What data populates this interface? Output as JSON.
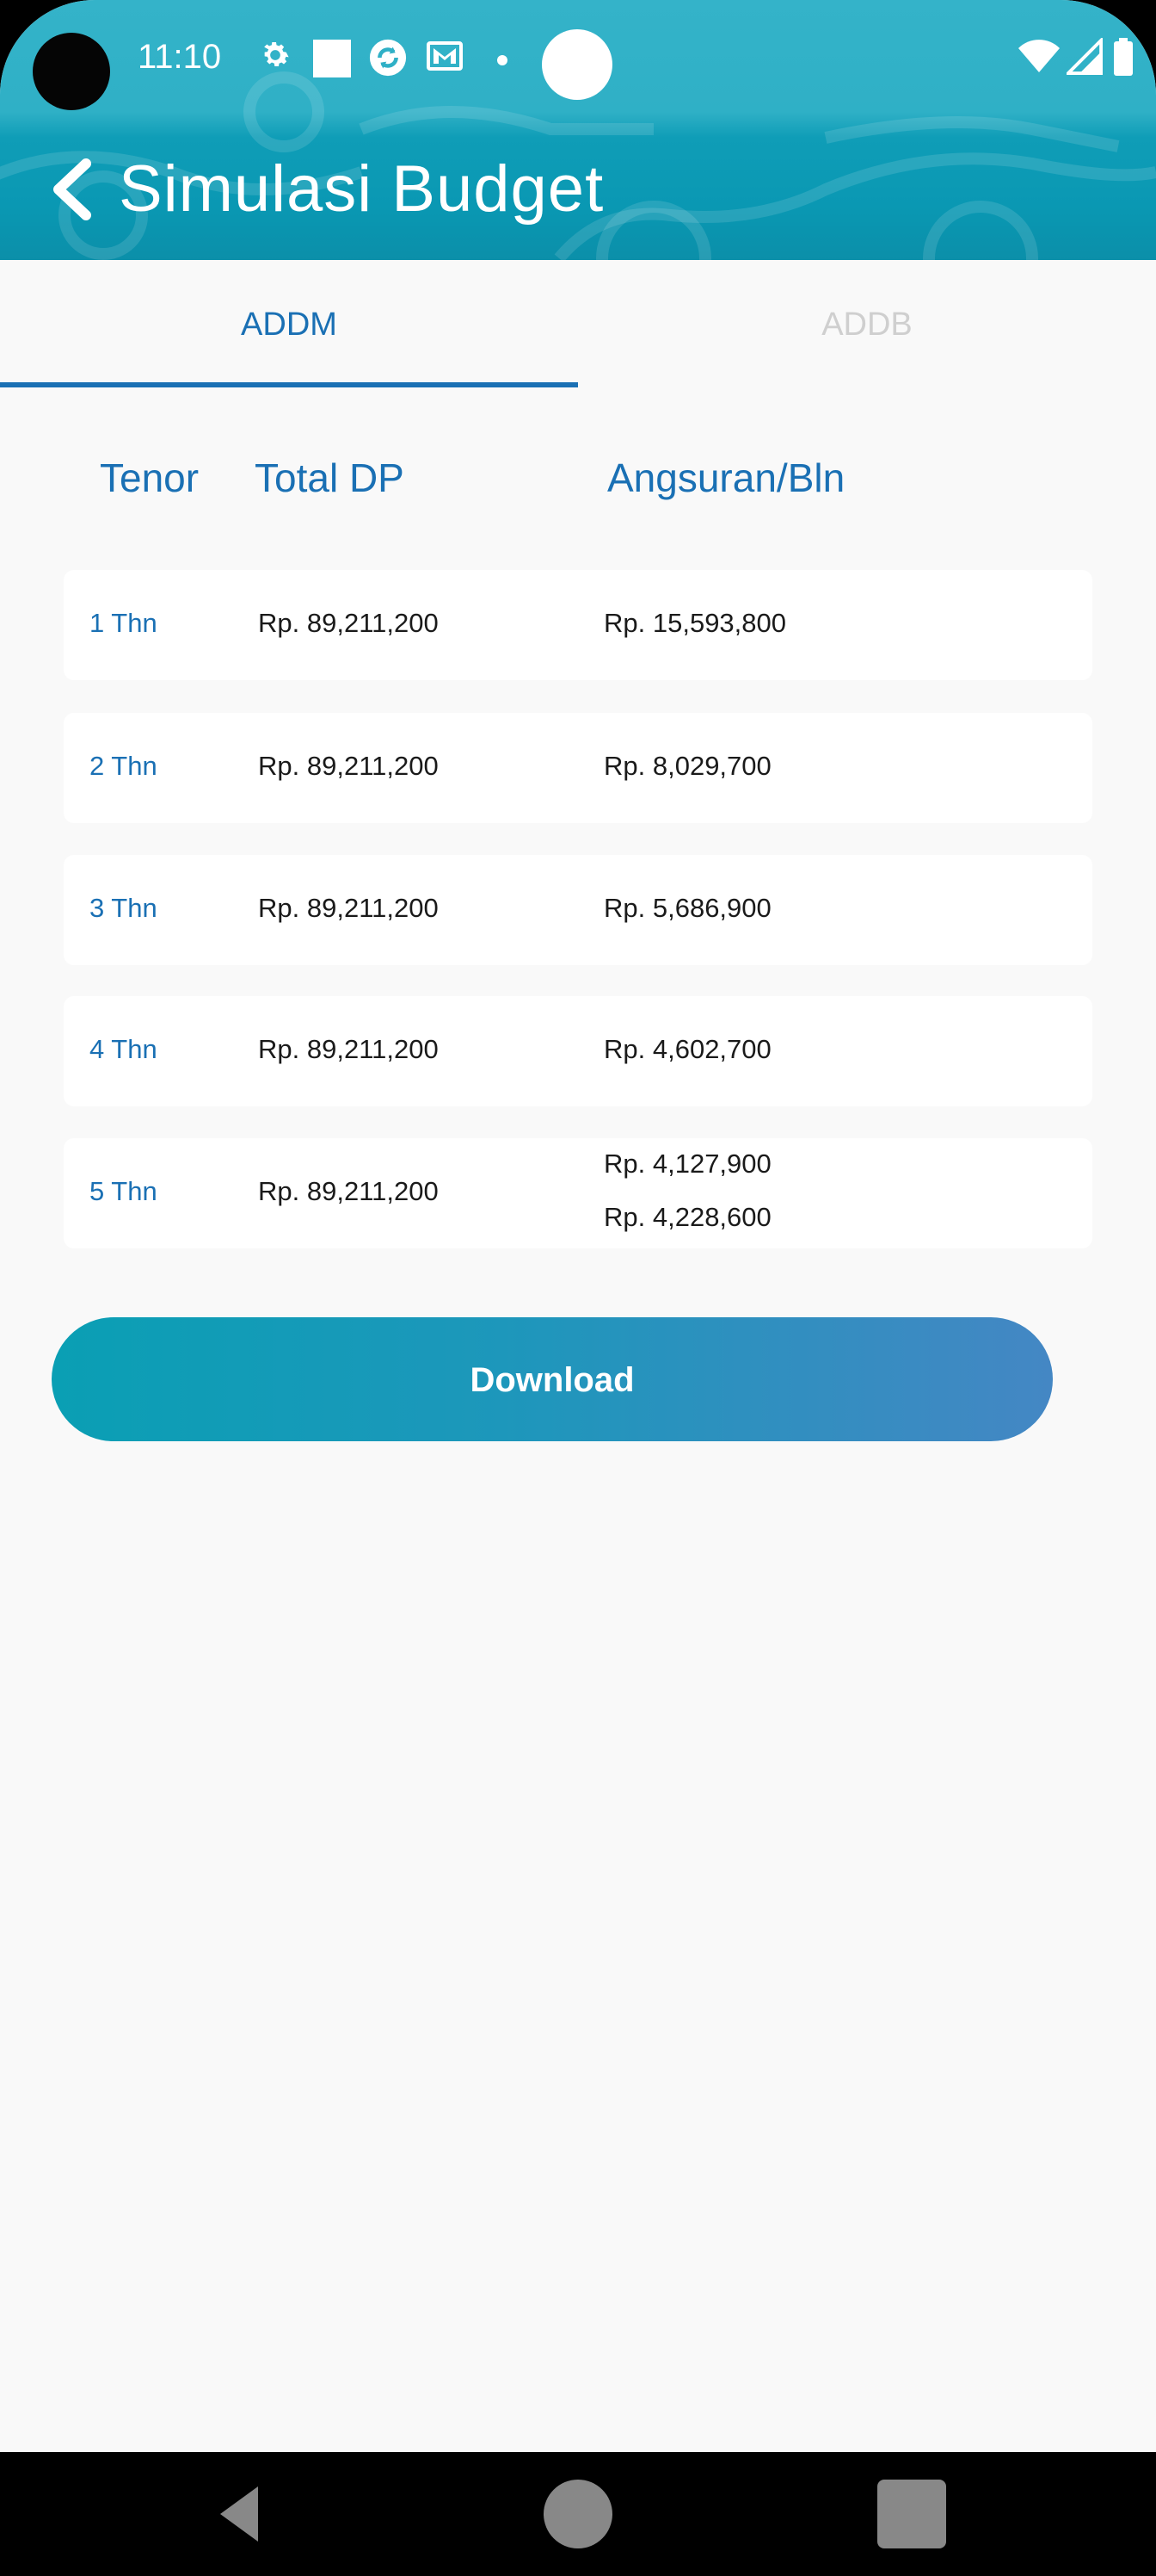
{
  "status_bar": {
    "time": "11:10"
  },
  "header": {
    "title": "Simulasi Budget"
  },
  "tabs": [
    {
      "label": "ADDM",
      "selected": true
    },
    {
      "label": "ADDB",
      "selected": false
    }
  ],
  "table": {
    "headers": [
      "Tenor",
      "Total DP",
      "Angsuran/Bln"
    ],
    "rows": [
      {
        "tenor": "1 Thn",
        "total_dp": "Rp. 89,211,200",
        "angsuran": [
          "Rp. 15,593,800"
        ]
      },
      {
        "tenor": "2 Thn",
        "total_dp": "Rp. 89,211,200",
        "angsuran": [
          "Rp. 8,029,700"
        ]
      },
      {
        "tenor": "3 Thn",
        "total_dp": "Rp. 89,211,200",
        "angsuran": [
          "Rp. 5,686,900"
        ]
      },
      {
        "tenor": "4 Thn",
        "total_dp": "Rp. 89,211,200",
        "angsuran": [
          "Rp. 4,602,700"
        ]
      },
      {
        "tenor": "5 Thn",
        "total_dp": "Rp. 89,211,200",
        "angsuran": [
          "Rp. 4,127,900",
          "Rp. 4,228,600"
        ]
      }
    ]
  },
  "download_button": {
    "label": "Download"
  },
  "colors": {
    "accent_blue": "#1a70b4",
    "header_teal": "#0a98b3",
    "button_start": "#0a9fb4",
    "button_end": "#4487c4",
    "tab_inactive": "#cfcfcf"
  },
  "icons": {
    "status": [
      "settings-icon",
      "square-notification-icon",
      "sync-icon",
      "mail-icon",
      "dot-icon",
      "wifi-icon",
      "signal-icon",
      "battery-icon"
    ],
    "navigation": [
      "nav-back-icon",
      "nav-home-icon",
      "nav-recents-icon"
    ],
    "header": "back-arrow-icon"
  }
}
